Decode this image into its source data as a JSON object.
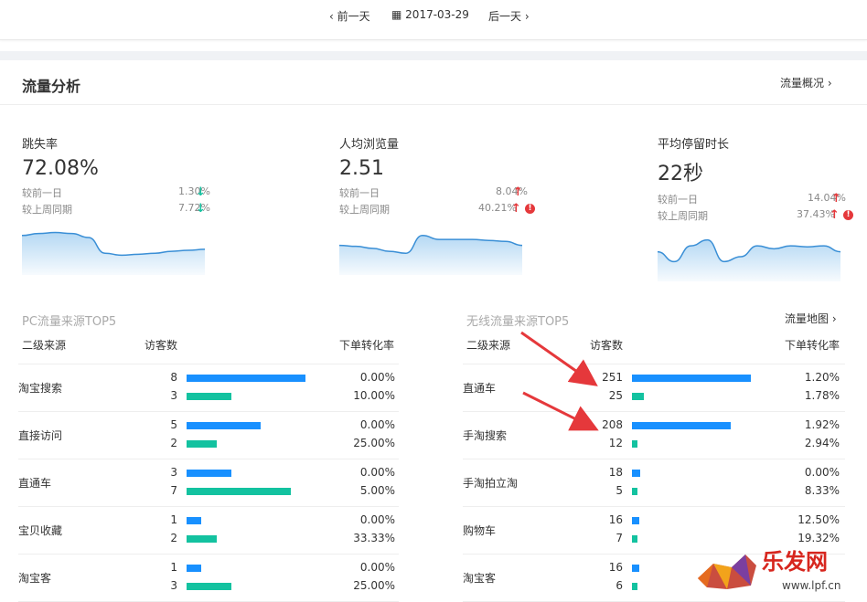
{
  "datebar": {
    "prev_label": "前一天",
    "date": "2017-03-29",
    "next_label": "后一天"
  },
  "header": {
    "title": "流量分析",
    "overview_link": "流量概况"
  },
  "metrics": [
    {
      "name": "跳失率",
      "value": "72.08%",
      "cmp": [
        {
          "label": "较前一日",
          "pct": "1.30%",
          "dir": "down",
          "warn": false
        },
        {
          "label": "较上周同期",
          "pct": "7.72%",
          "dir": "down",
          "warn": false
        }
      ],
      "trend": [
        40,
        42,
        43,
        42,
        38,
        22,
        20,
        21,
        22,
        24,
        25,
        26
      ]
    },
    {
      "name": "人均浏览量",
      "value": "2.51",
      "cmp": [
        {
          "label": "较前一日",
          "pct": "8.04%",
          "dir": "up",
          "warn": false
        },
        {
          "label": "较上周同期",
          "pct": "40.21%",
          "dir": "up",
          "warn": true
        }
      ],
      "trend": [
        30,
        29,
        27,
        24,
        22,
        40,
        36,
        36,
        36,
        35,
        34,
        30
      ]
    },
    {
      "name": "平均停留时长",
      "value": "22秒",
      "cmp": [
        {
          "label": "较前一日",
          "pct": "14.04%",
          "dir": "up",
          "warn": false
        },
        {
          "label": "较上周同期",
          "pct": "37.43%",
          "dir": "up",
          "warn": true
        }
      ],
      "trend": [
        30,
        20,
        36,
        42,
        20,
        25,
        36,
        33,
        36,
        35,
        36,
        30
      ]
    }
  ],
  "pc": {
    "title": "PC流量来源TOP5",
    "headers": {
      "source": "二级来源",
      "visitors": "访客数",
      "conv": "下单转化率"
    },
    "rows": [
      {
        "source": "淘宝搜索",
        "v1": 8,
        "v2": 3,
        "c1": "0.00%",
        "c2": "10.00%"
      },
      {
        "source": "直接访问",
        "v1": 5,
        "v2": 2,
        "c1": "0.00%",
        "c2": "25.00%"
      },
      {
        "source": "直通车",
        "v1": 3,
        "v2": 7,
        "c1": "0.00%",
        "c2": "5.00%"
      },
      {
        "source": "宝贝收藏",
        "v1": 1,
        "v2": 2,
        "c1": "0.00%",
        "c2": "33.33%"
      },
      {
        "source": "淘宝客",
        "v1": 1,
        "v2": 3,
        "c1": "0.00%",
        "c2": "25.00%"
      }
    ]
  },
  "wireless": {
    "title": "无线流量来源TOP5",
    "map_link": "流量地图",
    "headers": {
      "source": "二级来源",
      "visitors": "访客数",
      "conv": "下单转化率"
    },
    "rows": [
      {
        "source": "直通车",
        "v1": 251,
        "v2": 25,
        "c1": "1.20%",
        "c2": "1.78%"
      },
      {
        "source": "手淘搜索",
        "v1": 208,
        "v2": 12,
        "c1": "1.92%",
        "c2": "2.94%"
      },
      {
        "source": "手淘拍立淘",
        "v1": 18,
        "v2": 5,
        "c1": "0.00%",
        "c2": "8.33%"
      },
      {
        "source": "购物车",
        "v1": 16,
        "v2": 7,
        "c1": "12.50%",
        "c2": "19.32%"
      },
      {
        "source": "淘宝客",
        "v1": 16,
        "v2": 6,
        "c1": "",
        "c2": ""
      }
    ]
  },
  "watermark": {
    "text": "乐发网",
    "url": "www.lpf.cn"
  },
  "colors": {
    "blue": "#1890ff",
    "green": "#13c2a0",
    "down": "#13c2a0",
    "up": "#e5383b",
    "annotation": "#e5383b"
  }
}
